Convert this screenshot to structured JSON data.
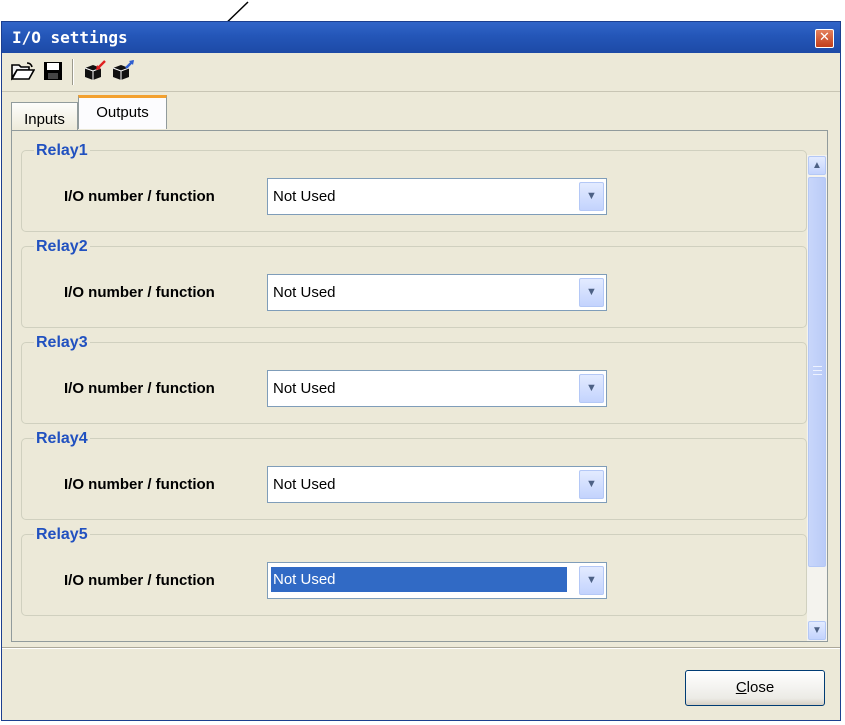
{
  "window": {
    "title": "I/O settings"
  },
  "toolbar": {
    "buttons": [
      {
        "name": "open-folder-icon"
      },
      {
        "name": "save-icon"
      },
      {
        "name": "import-icon"
      },
      {
        "name": "export-icon"
      }
    ]
  },
  "tabs": [
    {
      "label": "Inputs",
      "active": false
    },
    {
      "label": "Outputs",
      "active": true
    }
  ],
  "relays": [
    {
      "title": "Relay1",
      "field_label": "I/O number / function",
      "value": "Not Used",
      "focused": false
    },
    {
      "title": "Relay2",
      "field_label": "I/O number / function",
      "value": "Not Used",
      "focused": false
    },
    {
      "title": "Relay3",
      "field_label": "I/O number / function",
      "value": "Not Used",
      "focused": false
    },
    {
      "title": "Relay4",
      "field_label": "I/O number / function",
      "value": "Not Used",
      "focused": false
    },
    {
      "title": "Relay5",
      "field_label": "I/O number / function",
      "value": "Not Used",
      "focused": true
    }
  ],
  "footer": {
    "close_label": "Close",
    "close_accesskey": "C"
  },
  "colors": {
    "titlebar": "#2456b8",
    "legend": "#2151c0",
    "selection": "#316ac5",
    "active_tab_accent": "#f3a130"
  }
}
